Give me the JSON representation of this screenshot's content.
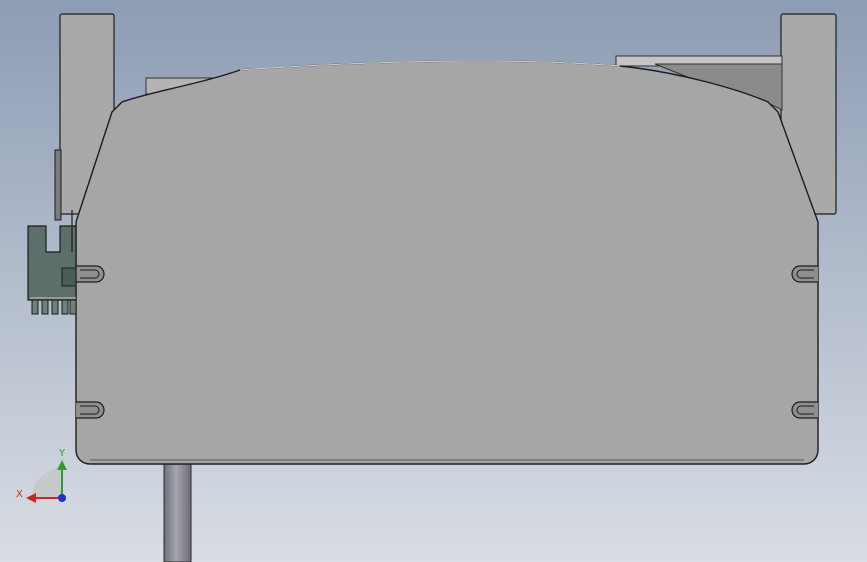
{
  "viewport": {
    "background_top": "#8d9cb4",
    "background_bottom": "#d9dde4"
  },
  "model": {
    "body_color": "#a6a6a6",
    "body_edge_color": "#1c1c1c",
    "bracket_color": "#a9a9a9",
    "connector_color": "#5c6f6a",
    "rod_color": "#8d8e98"
  },
  "triad": {
    "x_label": "X",
    "y_label": "Y",
    "x_color": "#c62828",
    "y_color": "#2e9e2e",
    "z_color": "#1e2fd0"
  }
}
